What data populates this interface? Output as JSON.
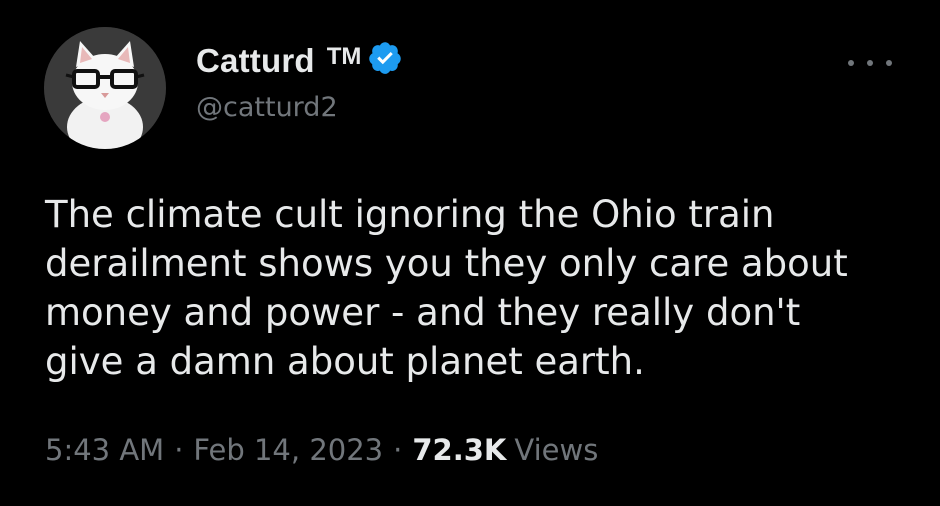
{
  "author": {
    "display_name": "Catturd",
    "trademark": "TM",
    "handle": "@catturd2",
    "avatar_icon": "cat-with-glasses-avatar",
    "verified_icon": "verified-badge-icon",
    "verified_color": "#1d9bf0"
  },
  "tweet": {
    "text": "The climate cult ignoring the Ohio train\nderailment shows you they only care about\nmoney and power - and they really don't\ngive a damn about planet earth."
  },
  "meta": {
    "time": "5:43 AM",
    "separator": "·",
    "date": "Feb 14, 2023",
    "views_count": "72.3K",
    "views_label": "Views"
  },
  "menu": {
    "icon": "more-options-icon"
  },
  "colors": {
    "background": "#000000",
    "primary_text": "#e7e9ea",
    "secondary_text": "#71767b"
  }
}
